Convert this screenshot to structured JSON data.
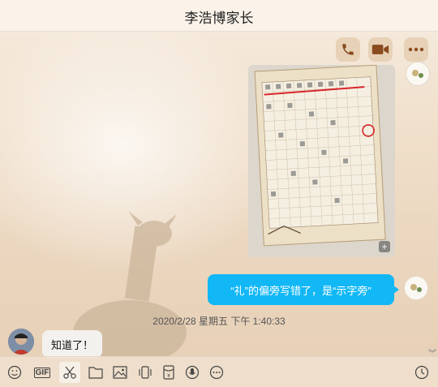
{
  "window": {
    "title": "李浩博家长"
  },
  "header_actions": [
    {
      "name": "phone-call-button",
      "icon": "phone-icon"
    },
    {
      "name": "video-call-button",
      "icon": "video-camera-icon"
    },
    {
      "name": "more-button",
      "icon": "more-dots-icon"
    }
  ],
  "messages": [
    {
      "type": "image",
      "sender": "me",
      "image_badge": "+"
    },
    {
      "type": "text",
      "sender": "me",
      "text": "“礼”的偏旁写错了，是“示字旁”"
    }
  ],
  "timestamp": "2020/2/28 星期五 下午 1:40:33",
  "peer_message": {
    "text": "知道了！"
  },
  "toolbar": {
    "gif_label": "GIF",
    "tools": [
      "emoji-icon",
      "gif-icon",
      "scissors-icon",
      "folder-icon",
      "image-icon",
      "shake-icon",
      "red-packet-icon",
      "voice-icon",
      "more-dots-icon",
      "history-clock-icon"
    ]
  },
  "colors": {
    "accent": "#12b7f5",
    "call_button_bg": "#e4ceb2",
    "icon": "#8a4b1f"
  }
}
